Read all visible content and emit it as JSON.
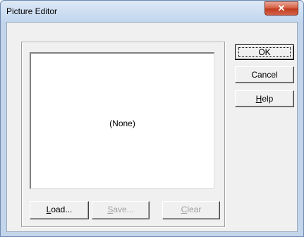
{
  "window": {
    "title": "Picture Editor",
    "close_glyph": "✕"
  },
  "picture": {
    "placeholder": "(None)"
  },
  "bottom_buttons": [
    {
      "label": "Load...",
      "mnemonic_index": 0,
      "enabled": true
    },
    {
      "label": "Save...",
      "mnemonic_index": 0,
      "enabled": false
    },
    {
      "label": "Clear",
      "mnemonic_index": 0,
      "enabled": false
    }
  ],
  "side_buttons": [
    {
      "label": "OK",
      "default": true
    },
    {
      "label": "Cancel"
    },
    {
      "label": "Help"
    }
  ],
  "colors": {
    "title_bg": "#c3d5ea",
    "dialog_bg": "#f0f0f0",
    "close_red": "#c0391b",
    "disabled_text": "#a0a0a0"
  },
  "icons": {
    "close": "close-icon"
  }
}
